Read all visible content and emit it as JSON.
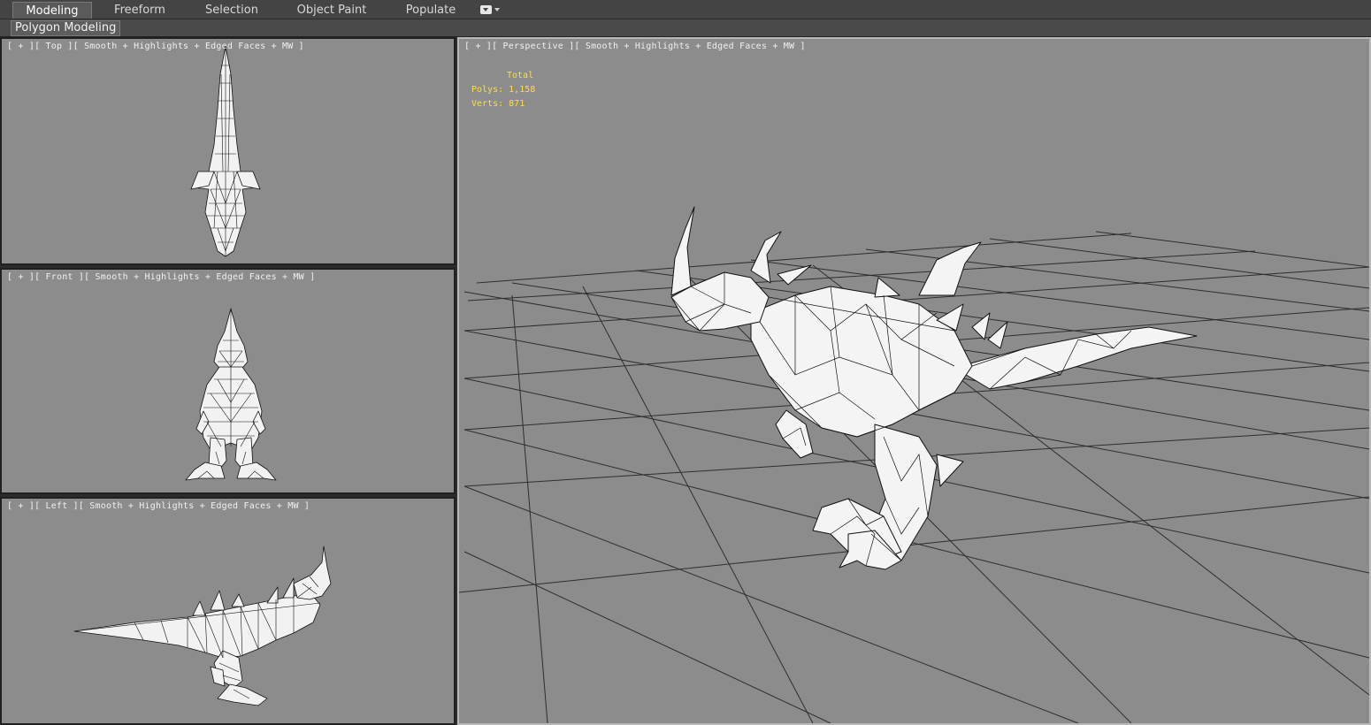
{
  "ribbon": {
    "tabs": [
      {
        "label": "Modeling",
        "active": true
      },
      {
        "label": "Freeform",
        "active": false
      },
      {
        "label": "Selection",
        "active": false
      },
      {
        "label": "Object Paint",
        "active": false
      },
      {
        "label": "Populate",
        "active": false
      }
    ],
    "expand_icon": "dropdown-toggle-icon",
    "panel_label": "Polygon Modeling"
  },
  "viewports": {
    "top": {
      "label": "[ + ][ Top ][ Smooth + Highlights + Edged Faces + MW ]"
    },
    "front": {
      "label": "[ + ][ Front ][ Smooth + Highlights + Edged Faces + MW ]"
    },
    "left": {
      "label": "[ + ][ Left ][ Smooth + Highlights + Edged Faces + MW ]"
    },
    "perspective": {
      "label": "[ + ][ Perspective ][ Smooth + Highlights + Edged Faces + MW ]"
    }
  },
  "stats": {
    "header": "Total",
    "polys_label": "Polys:",
    "polys_value": "1,158",
    "verts_label": "Verts:",
    "verts_value": "871"
  },
  "colors": {
    "viewport_bg": "#8c8c8c",
    "stats_text": "#ffe03a",
    "grid_line": "#2e2e2e",
    "model_fill": "#f2f2f2",
    "wire": "#111111"
  }
}
